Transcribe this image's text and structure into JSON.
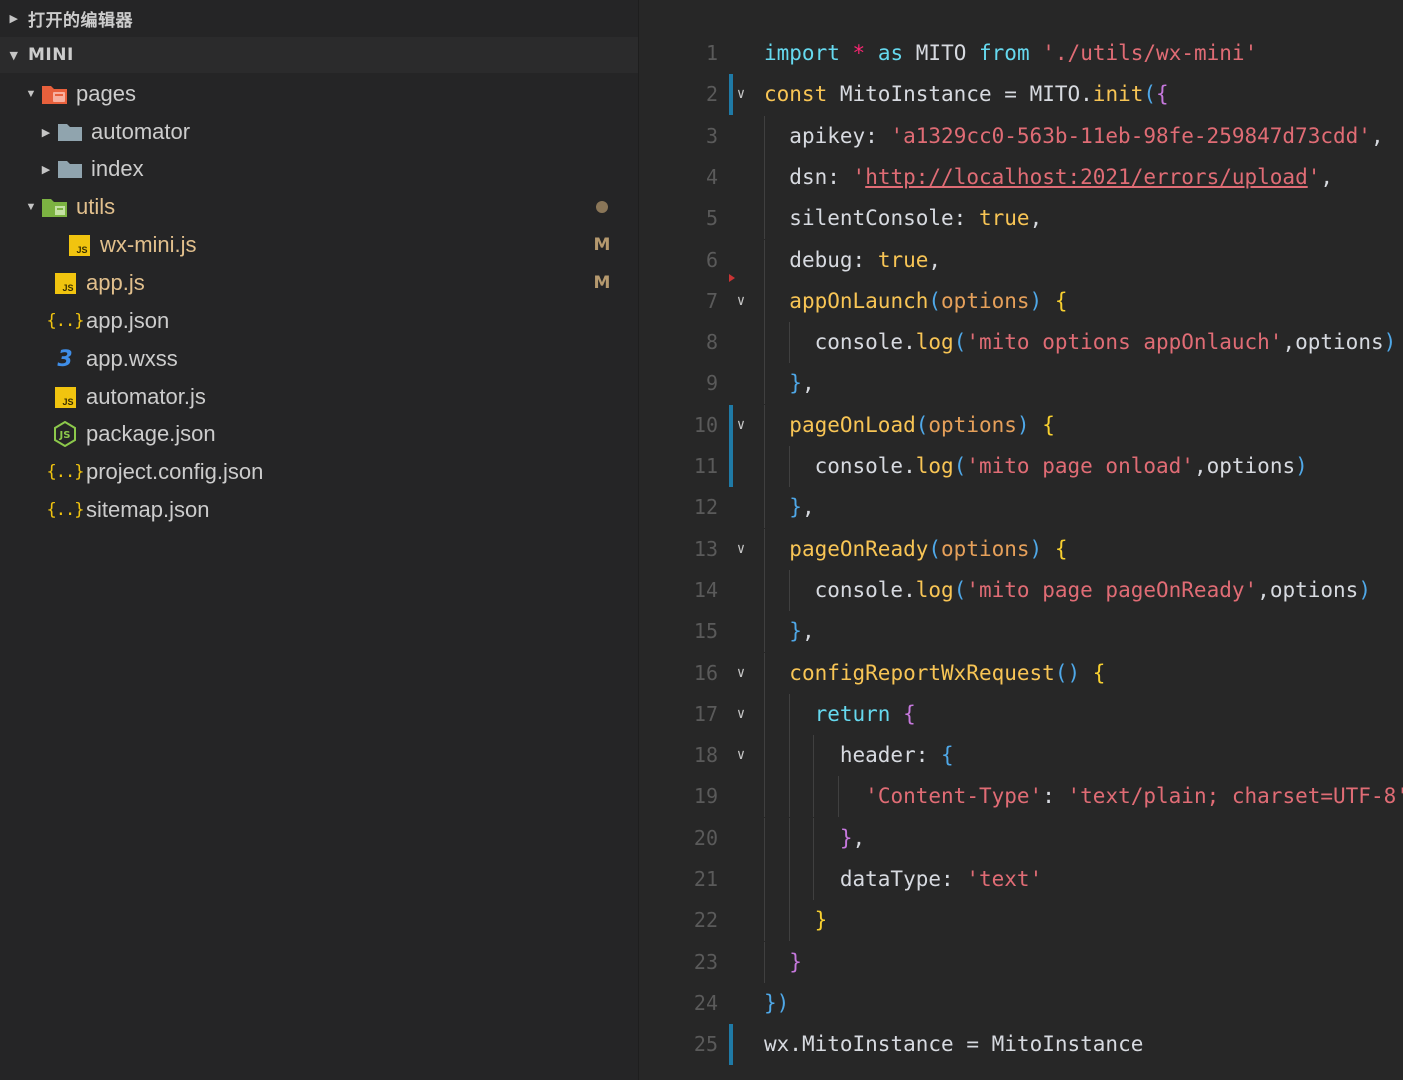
{
  "sidebar": {
    "open_editors_label": "打开的编辑器",
    "project_label": "MINI",
    "tree": [
      {
        "name": "pages",
        "type": "folder-pages",
        "open": true
      },
      {
        "name": "automator",
        "type": "folder",
        "open": false
      },
      {
        "name": "index",
        "type": "folder",
        "open": false
      },
      {
        "name": "utils",
        "type": "folder-utils",
        "open": true,
        "modified": true,
        "badge": "●"
      },
      {
        "name": "wx-mini.js",
        "type": "js",
        "modified": true,
        "badge": "M"
      },
      {
        "name": "app.js",
        "type": "js",
        "modified": true,
        "badge": "M"
      },
      {
        "name": "app.json",
        "type": "json"
      },
      {
        "name": "app.wxss",
        "type": "css"
      },
      {
        "name": "automator.js",
        "type": "js"
      },
      {
        "name": "package.json",
        "type": "node"
      },
      {
        "name": "project.config.json",
        "type": "json"
      },
      {
        "name": "sitemap.json",
        "type": "json"
      }
    ],
    "icons": {
      "js_label": "JS",
      "json_label": "{..}",
      "css_label": "3"
    }
  },
  "editor": {
    "lines": [
      {
        "n": "1",
        "text": "import * as MITO from './utils/wx-mini'"
      },
      {
        "n": "2",
        "text": "const MitoInstance = MITO.init({"
      },
      {
        "n": "3",
        "text": "  apikey: 'a1329cc0-563b-11eb-98fe-259847d73cdd',"
      },
      {
        "n": "4",
        "text": "  dsn: 'http://localhost:2021/errors/upload',"
      },
      {
        "n": "5",
        "text": "  silentConsole: true,"
      },
      {
        "n": "6",
        "text": "  debug: true,"
      },
      {
        "n": "7",
        "text": "  appOnLaunch(options) {"
      },
      {
        "n": "8",
        "text": "    console.log('mito options appOnlauch',options)"
      },
      {
        "n": "9",
        "text": "  },"
      },
      {
        "n": "10",
        "text": "  pageOnLoad(options) {"
      },
      {
        "n": "11",
        "text": "    console.log('mito page onload',options)"
      },
      {
        "n": "12",
        "text": "  },"
      },
      {
        "n": "13",
        "text": "  pageOnReady(options) {"
      },
      {
        "n": "14",
        "text": "    console.log('mito page pageOnReady',options)"
      },
      {
        "n": "15",
        "text": "  },"
      },
      {
        "n": "16",
        "text": "  configReportWxRequest() {"
      },
      {
        "n": "17",
        "text": "    return {"
      },
      {
        "n": "18",
        "text": "      header: {"
      },
      {
        "n": "19",
        "text": "        'Content-Type': 'text/plain; charset=UTF-8'"
      },
      {
        "n": "20",
        "text": "      },"
      },
      {
        "n": "21",
        "text": "      dataType: 'text'"
      },
      {
        "n": "22",
        "text": "    }"
      },
      {
        "n": "23",
        "text": "  }"
      },
      {
        "n": "24",
        "text": "})"
      },
      {
        "n": "25",
        "text": "wx.MitoInstance = MitoInstance"
      }
    ],
    "fold_lines": [
      "2",
      "7",
      "10",
      "13",
      "16",
      "17",
      "18"
    ],
    "modified_lines": [
      "2",
      "10",
      "11",
      "25"
    ]
  },
  "colors": {
    "sidebar_bg": "#252526",
    "editor_bg": "#272727",
    "modified_text": "#e2c08d",
    "gutter_modified": "#1f7aa6",
    "js_icon": "#f1c40f",
    "css_icon": "#3f8ee8"
  }
}
